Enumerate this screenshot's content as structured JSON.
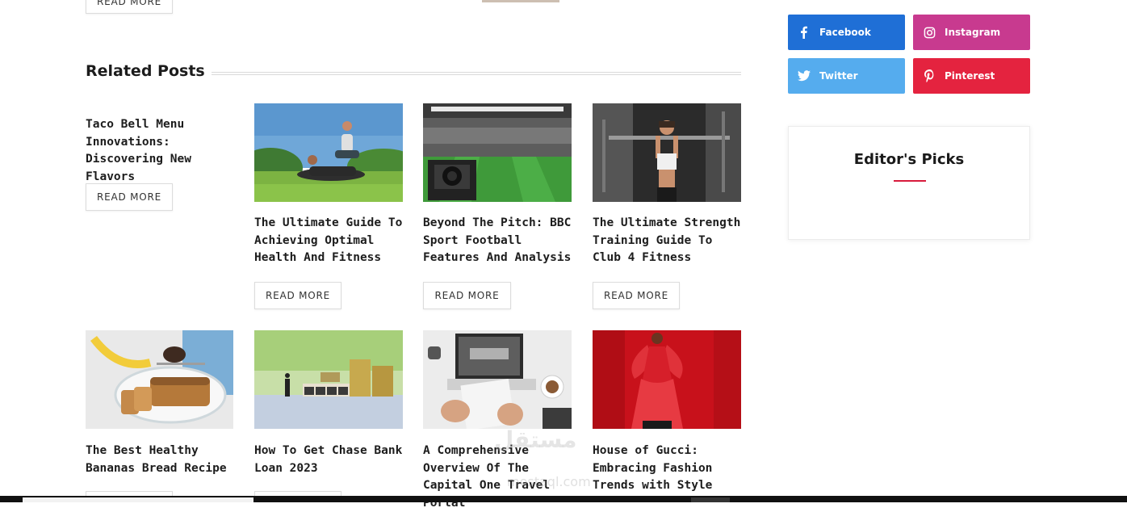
{
  "top": {
    "read_more_label": "READ MORE"
  },
  "related": {
    "title": "Related Posts",
    "read_more_label": "READ MORE",
    "text_post": {
      "title": "Taco Bell Menu Innovations: Discovering New Flavors"
    },
    "row1": [
      {
        "title": "The Ultimate Guide To Achieving Optimal Health And Fitness",
        "image": "couple-exercising-park-image"
      },
      {
        "title": "Beyond The Pitch: BBC Sport Football Features And Analysis",
        "image": "football-stadium-camera-image"
      },
      {
        "title": "The Ultimate Strength Training Guide To Club 4 Fitness",
        "image": "woman-gym-pulldown-image"
      }
    ],
    "row2": [
      {
        "title": "The Best Healthy Bananas Bread Recipe",
        "image": "banana-bread-image"
      },
      {
        "title": "How To Get Chase Bank Loan 2023",
        "image": "loan-coins-image"
      },
      {
        "title": "A Comprehensive Overview Of The Capital One Travel Portal",
        "image": "travel-laptop-image"
      },
      {
        "title": "House of Gucci: Embracing Fashion Trends with Style",
        "image": "red-dress-fashion-image"
      }
    ]
  },
  "social": [
    {
      "label": "Facebook",
      "icon": "facebook-icon",
      "color": "#1f6fd6"
    },
    {
      "label": "Instagram",
      "icon": "instagram-icon",
      "color": "#c83a8f"
    },
    {
      "label": "Twitter",
      "icon": "twitter-icon",
      "color": "#55acee"
    },
    {
      "label": "Pinterest",
      "icon": "pinterest-icon",
      "color": "#e4233f"
    }
  ],
  "sidebar": {
    "editors_picks_title": "Editor's Picks"
  },
  "colors": {
    "accent": "#d81b3c"
  }
}
